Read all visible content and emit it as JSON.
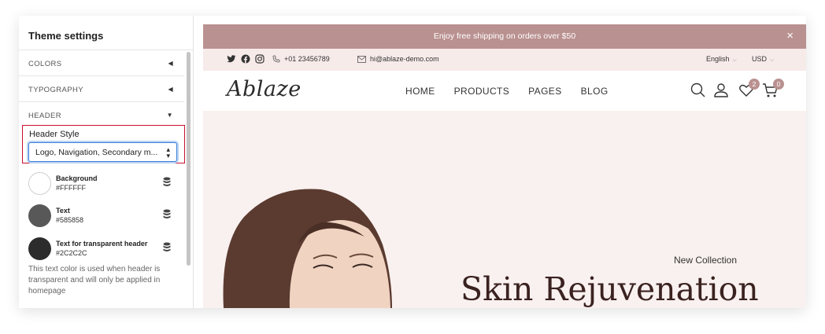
{
  "sidebar": {
    "title": "Theme settings",
    "sections": [
      {
        "label": "COLORS",
        "expanded": false
      },
      {
        "label": "TYPOGRAPHY",
        "expanded": false
      },
      {
        "label": "HEADER",
        "expanded": true
      }
    ],
    "header_style": {
      "label": "Header Style",
      "value": "Logo, Navigation, Secondary m..."
    },
    "colors": [
      {
        "name": "Background",
        "value": "#FFFFFF",
        "swatch": "#FFFFFF"
      },
      {
        "name": "Text",
        "value": "#585858",
        "swatch": "#585858"
      },
      {
        "name": "Text for transparent header",
        "value": "#2C2C2C",
        "swatch": "#2C2C2C"
      }
    ],
    "help_text": "This text color is used when header is transparent and will only be applied in homepage"
  },
  "preview": {
    "announcement": "Enjoy free shipping on orders over $50",
    "close_icon": "×",
    "topbar": {
      "social_icons": [
        "twitter-icon",
        "facebook-icon",
        "instagram-icon"
      ],
      "phone": "+01 23456789",
      "email": "hi@ablaze-demo.com",
      "language": "English",
      "currency": "USD"
    },
    "logo": "Ablaze",
    "nav": [
      "HOME",
      "PRODUCTS",
      "PAGES",
      "BLOG"
    ],
    "wishlist_count": "2",
    "cart_count": "0",
    "hero": {
      "subtitle": "New Collection",
      "title": "Skin Rejuvenation"
    },
    "colors": {
      "accent": "#b99190",
      "topbar_bg": "#f7ebea",
      "hero_bg": "#f9f1ef",
      "title": "#3a2220"
    }
  }
}
